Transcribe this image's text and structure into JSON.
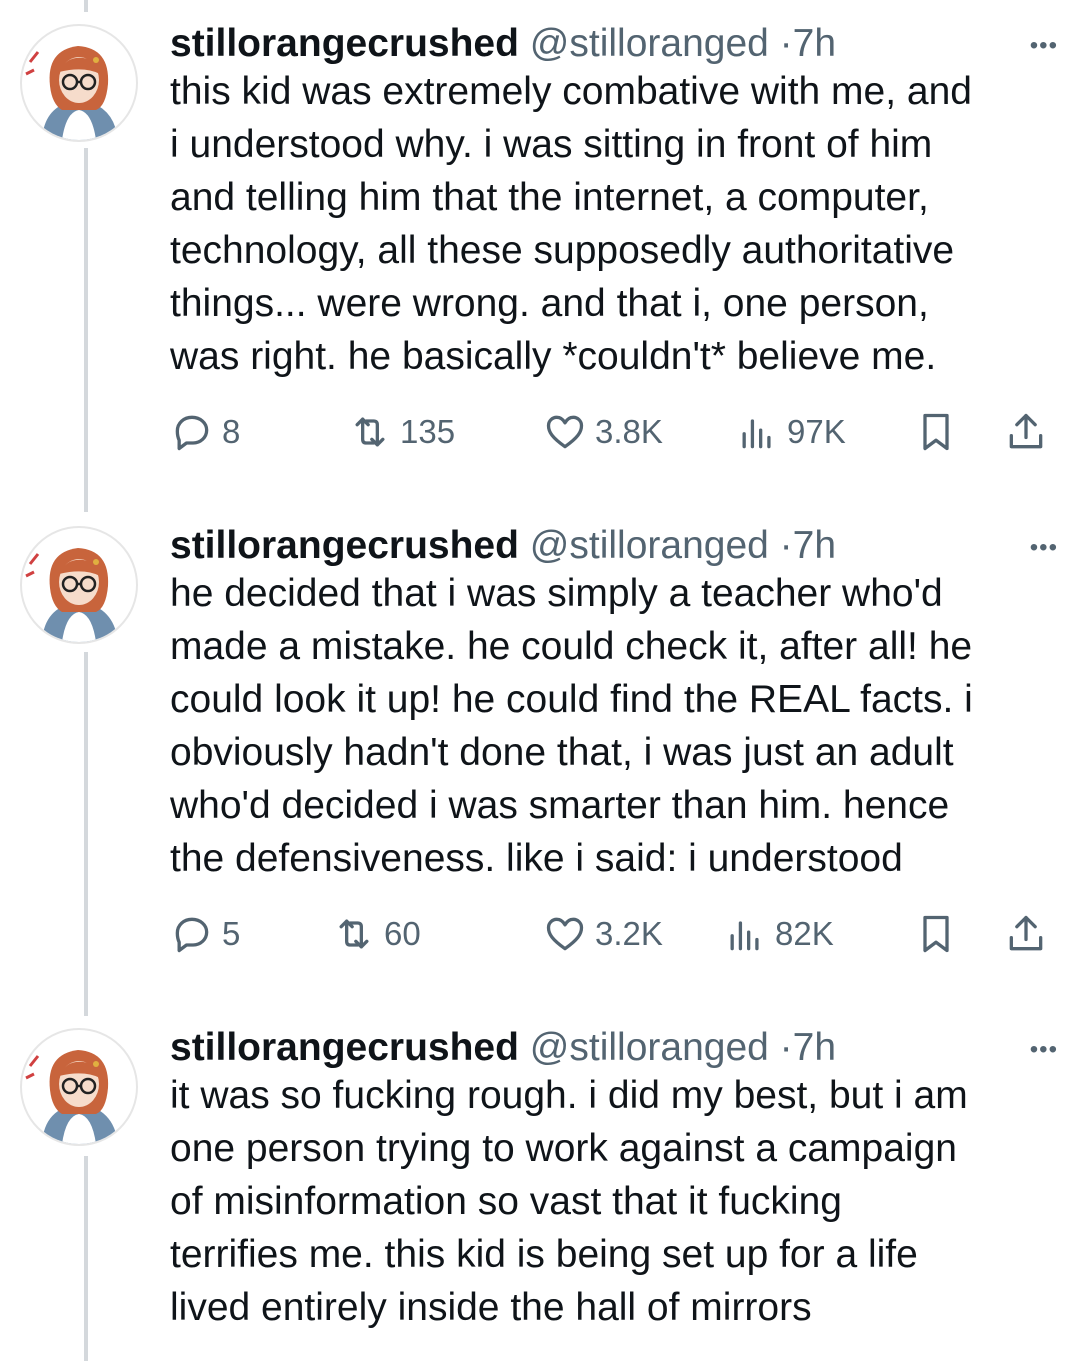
{
  "tweets": [
    {
      "display_name": "stillorangecrushed",
      "handle": "@stilloranged",
      "separator": "·",
      "time": "7h",
      "more_icon": "more-dots-icon",
      "text": "this kid was extremely combative with me, and\ni understood why. i was sitting in front of him\nand telling him that the internet, a computer,\ntechnology, all these supposedly authoritative\nthings... were wrong. and that i, one person,\nwas right. he basically *couldn't* believe me.",
      "replies": "8",
      "retweets": "135",
      "likes": "3.8K",
      "views": "97K"
    },
    {
      "display_name": "stillorangecrushed",
      "handle": "@stilloranged",
      "separator": "·",
      "time": "7h",
      "more_icon": "more-dots-icon",
      "text": "he decided that i was simply a teacher who'd\nmade a mistake. he could check it, after all! he\ncould look it up! he could find the REAL facts. i\nobviously hadn't done that, i was just an adult\nwho'd decided i was smarter than him. hence\nthe defensiveness. like i said: i understood",
      "replies": "5",
      "retweets": "60",
      "likes": "3.2K",
      "views": "82K"
    },
    {
      "display_name": "stillorangecrushed",
      "handle": "@stilloranged",
      "separator": "·",
      "time": "7h",
      "more_icon": "more-dots-icon",
      "text": "it was so fucking rough. i did my best, but i am\none person trying to work against a campaign\nof misinformation so vast that it fucking\nterrifies me. this kid is being set up for a life\nlived entirely inside the hall of mirrors"
    }
  ],
  "colors": {
    "text": "#0f1419",
    "secondary": "#536471",
    "thread_line": "#d4d8dc",
    "avatar_hair": "#c8643c",
    "avatar_jacket": "#6f8fae"
  }
}
